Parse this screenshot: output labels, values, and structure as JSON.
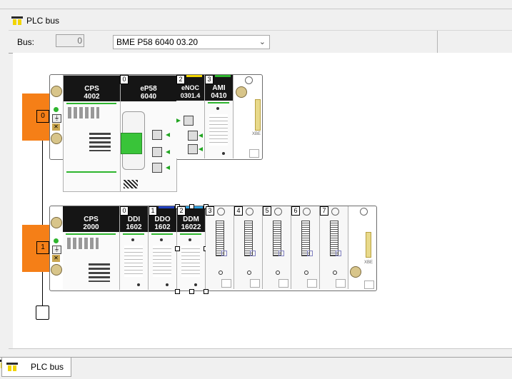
{
  "window": {
    "title": "PLC bus"
  },
  "toolbar": {
    "bus_label": "Bus:",
    "bus_value": "0",
    "cpu_selected": "BME P58 6040   03.20"
  },
  "racks": [
    {
      "number": "0",
      "modules": [
        {
          "slot": "",
          "line1": "CPS",
          "line2": "4002"
        },
        {
          "slot": "0",
          "line1": "eP58",
          "line2": "6040"
        },
        {
          "slot": "2",
          "line1": "eNOC",
          "line2": "0301.4"
        },
        {
          "slot": "3",
          "line1": "AMI",
          "line2": "0410"
        }
      ],
      "end_label": "XBE"
    },
    {
      "number": "1",
      "modules": [
        {
          "slot": "",
          "line1": "CPS",
          "line2": "2000"
        },
        {
          "slot": "0",
          "line1": "DDI",
          "line2": "1602"
        },
        {
          "slot": "1",
          "line1": "DDO",
          "line2": "1602"
        },
        {
          "slot": "2",
          "line1": "DDM",
          "line2": "16022"
        }
      ],
      "empty_slots": [
        "3",
        "4",
        "5",
        "6",
        "7"
      ],
      "end_label": "XBE"
    }
  ],
  "tabs": [
    {
      "label": "PLC bus"
    }
  ],
  "colors": {
    "rack_marker": "#f57f17",
    "status_green": "#2eb52e"
  }
}
